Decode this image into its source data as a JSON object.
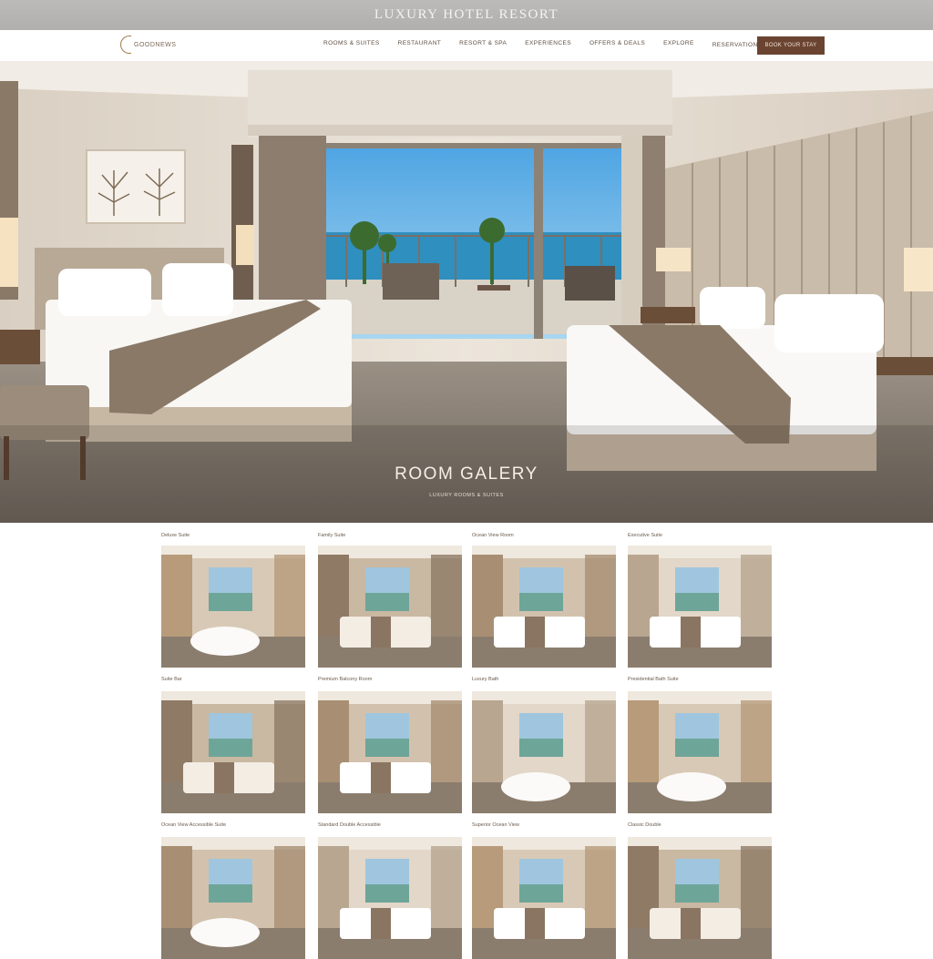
{
  "window": {
    "title": "LUXURY HOTEL RESORT"
  },
  "nav": {
    "logo_text": "GOODNEWS",
    "links": [
      "ROOMS & SUITES",
      "RESTAURANT",
      "RESORT & SPA",
      "EXPERIENCES",
      "OFFERS & DEALS",
      "EXPLORE",
      "RESERVATIONS"
    ],
    "book_label": "BOOK YOUR STAY"
  },
  "hero": {
    "title": "ROOM GALERY",
    "subtitle": "LUXURY ROOMS & SUITES"
  },
  "gallery": {
    "captions": [
      "Deluxe Suite",
      "Family Suite",
      "Ocean View Room",
      "Executive Suite",
      "Suite Bar",
      "Premium Balcony Room",
      "Luxury Bath",
      "Presidential Bath Suite",
      "Ocean View Accessible Suite",
      "Standard Double Accessible",
      "Superior Ocean View",
      "Classic Double"
    ]
  },
  "colors": {
    "accent": "#6b4431",
    "wall": "#e9e1d6",
    "carpet": "#8b8174",
    "sea": "#2f8fbf",
    "sky": "#6fb6e6"
  }
}
